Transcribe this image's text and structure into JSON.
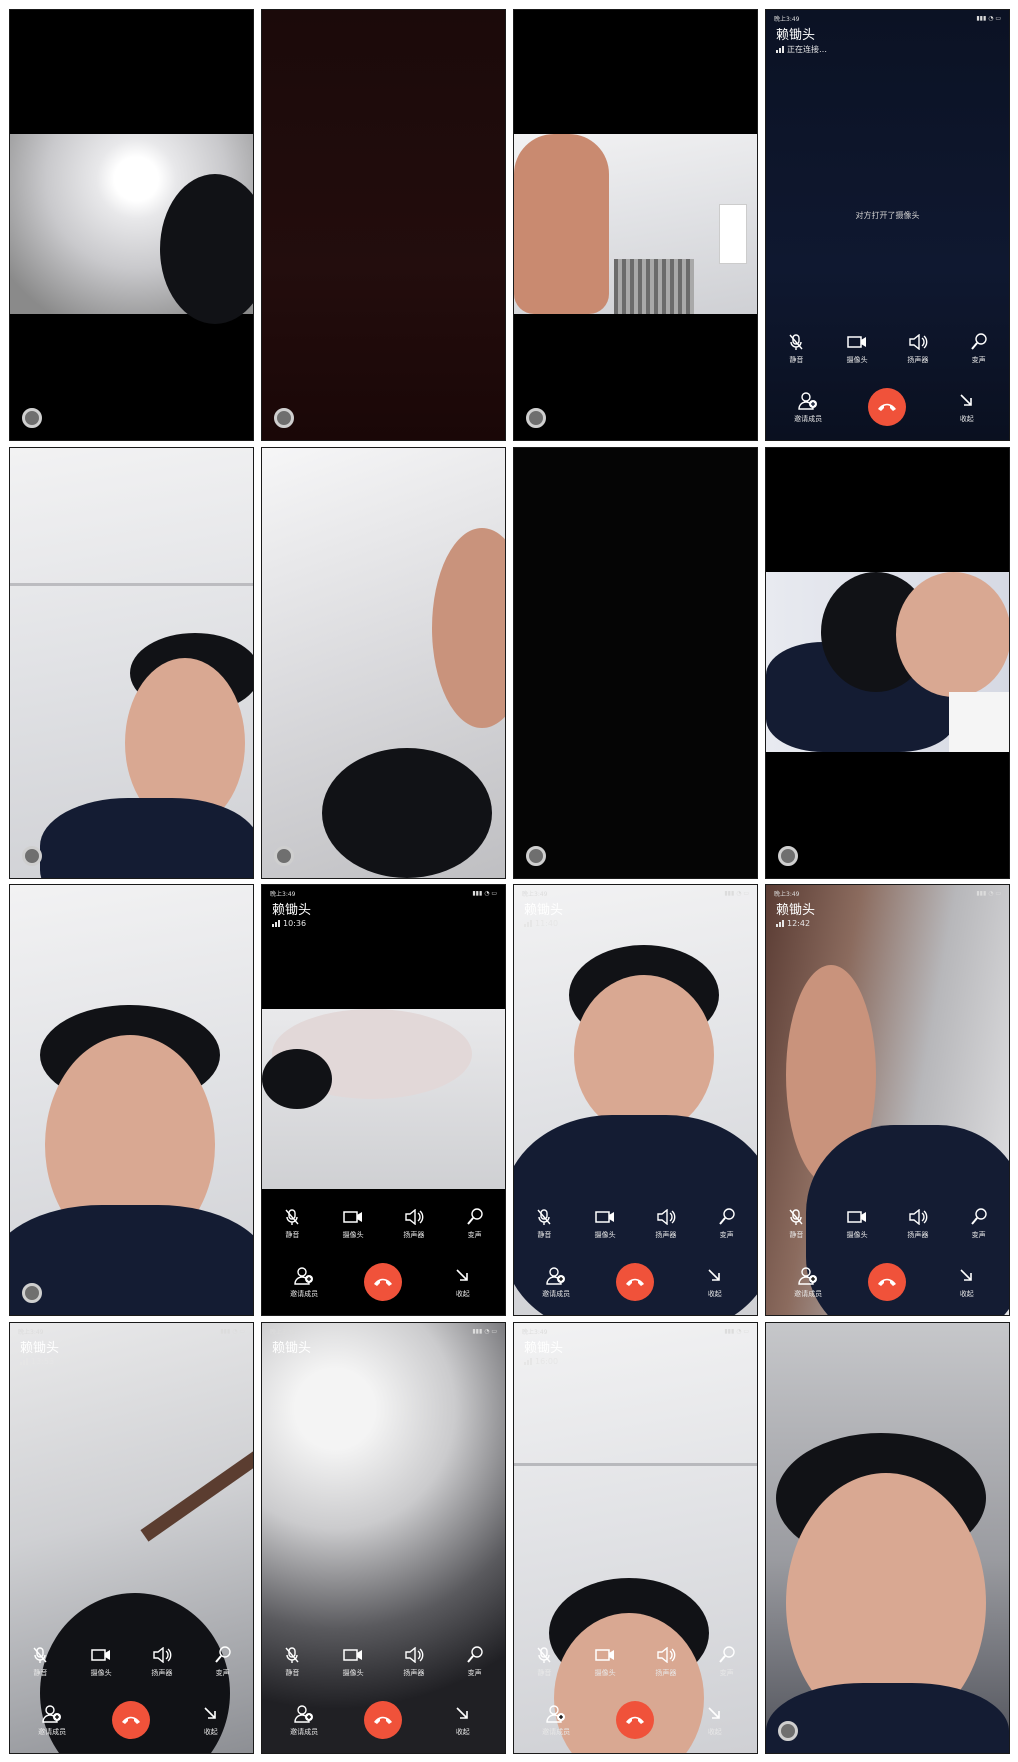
{
  "call": {
    "caller_name": "赖锄头",
    "connecting_text": "正在连接…",
    "camera_opened_text": "对方打开了摄像头",
    "timers": [
      "10:36",
      "11:40",
      "12:42",
      "13:53",
      "16:00"
    ],
    "controls": {
      "mute_label": "静音",
      "camera_label": "摄像头",
      "speaker_label": "扬声器",
      "changer_label": "变声",
      "invite_label": "邀请成员",
      "minimize_label": "收起"
    },
    "icons": {
      "mute": "mic-off-icon",
      "camera": "video-camera-icon",
      "speaker": "speaker-icon",
      "changer": "voice-changer-icon",
      "invite": "add-person-icon",
      "hangup": "hang-up-phone-icon",
      "minimize": "minimize-arrow-icon"
    },
    "colors": {
      "hangup": "#f0523a",
      "label": "#e8e8e8",
      "ui_background": "#0f1830"
    }
  },
  "statusbar": {
    "time": "晚上3:49"
  }
}
